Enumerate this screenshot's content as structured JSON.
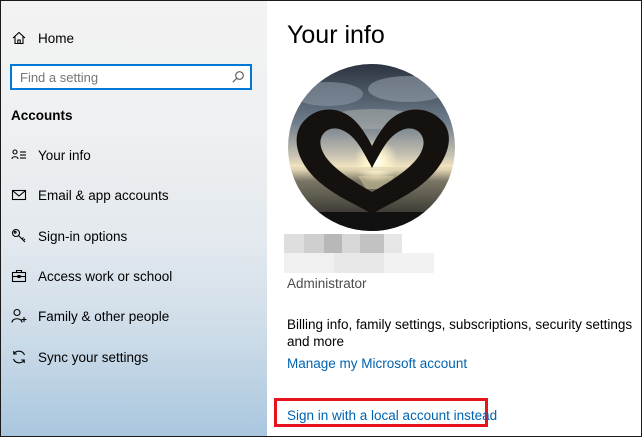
{
  "sidebar": {
    "home_label": "Home",
    "search": {
      "placeholder": "Find a setting",
      "value": ""
    },
    "section_heading": "Accounts",
    "items": [
      {
        "label": "Your info",
        "icon": "person-card-icon"
      },
      {
        "label": "Email & app accounts",
        "icon": "mail-icon"
      },
      {
        "label": "Sign-in options",
        "icon": "key-icon"
      },
      {
        "label": "Access work or school",
        "icon": "briefcase-icon"
      },
      {
        "label": "Family & other people",
        "icon": "people-add-icon"
      },
      {
        "label": "Sync your settings",
        "icon": "sync-icon"
      }
    ]
  },
  "main": {
    "title": "Your info",
    "avatar_icon": "profile-photo-heart-hands-sunset",
    "account_type": "Administrator",
    "billing_text": "Billing info, family settings, subscriptions, security settings and more",
    "manage_link": "Manage my Microsoft account",
    "local_account_link": "Sign in with a local account instead"
  },
  "colors": {
    "accent": "#0078d7",
    "link": "#0063b1",
    "highlight_box": "#e8141d"
  }
}
